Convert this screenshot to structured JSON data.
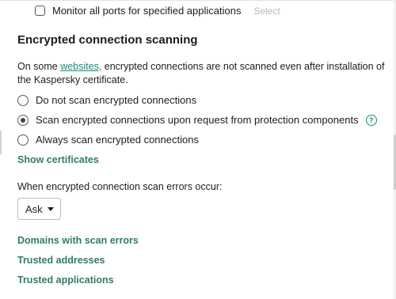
{
  "monitor_ports": {
    "label": "Monitor all ports for specified applications",
    "select_label": "Select",
    "checked": false
  },
  "section": {
    "title": "Encrypted connection scanning",
    "description_before": "On some ",
    "description_link": "websites,",
    "description_after": " encrypted connections are not scanned even after installation of the Kaspersky certificate."
  },
  "options": [
    {
      "label": "Do not scan encrypted connections",
      "selected": false
    },
    {
      "label": "Scan encrypted connections upon request from protection components",
      "selected": true
    },
    {
      "label": "Always scan encrypted connections",
      "selected": false
    }
  ],
  "help_icon_glyph": "?",
  "show_certificates": "Show certificates",
  "errors_label": "When encrypted connection scan errors occur:",
  "errors_dropdown": {
    "value": "Ask"
  },
  "links": {
    "domains": "Domains with scan errors",
    "trusted_addresses": "Trusted addresses",
    "trusted_applications": "Trusted applications"
  },
  "colors": {
    "accent": "#1a8a74",
    "link_bold": "#2e7d6b"
  }
}
